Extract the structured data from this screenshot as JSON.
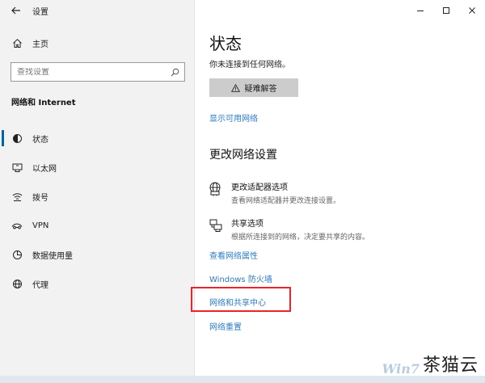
{
  "window": {
    "title": "设置"
  },
  "sidebar": {
    "home_label": "主页",
    "search_placeholder": "查找设置",
    "section_title": "网络和 Internet",
    "items": [
      {
        "label": "状态",
        "icon": "status-icon",
        "active": true
      },
      {
        "label": "以太网",
        "icon": "ethernet-icon",
        "active": false
      },
      {
        "label": "拨号",
        "icon": "dialup-icon",
        "active": false
      },
      {
        "label": "VPN",
        "icon": "vpn-icon",
        "active": false
      },
      {
        "label": "数据使用量",
        "icon": "data-usage-icon",
        "active": false
      },
      {
        "label": "代理",
        "icon": "proxy-icon",
        "active": false
      }
    ]
  },
  "main": {
    "title": "状态",
    "status_text": "你未连接到任何网络。",
    "troubleshoot_label": "疑难解答",
    "show_networks_link": "显示可用网络",
    "change_title": "更改网络设置",
    "options": [
      {
        "title": "更改适配器选项",
        "desc": "查看网络适配器并更改连接设置。",
        "icon": "adapter-icon"
      },
      {
        "title": "共享选项",
        "desc": "根据所连接到的网络，决定要共享的内容。",
        "icon": "sharing-icon"
      }
    ],
    "links": {
      "properties": "查看网络属性",
      "firewall": "Windows 防火墙",
      "sharing_center": "网络和共享中心",
      "reset": "网络重置"
    }
  },
  "watermark": {
    "logo": "Win7",
    "text": "茶猫云"
  },
  "colors": {
    "accent": "#0063b1",
    "link": "#2d7cc4",
    "highlight": "#e8262a",
    "sidebar_bg": "#f2f2f2"
  }
}
